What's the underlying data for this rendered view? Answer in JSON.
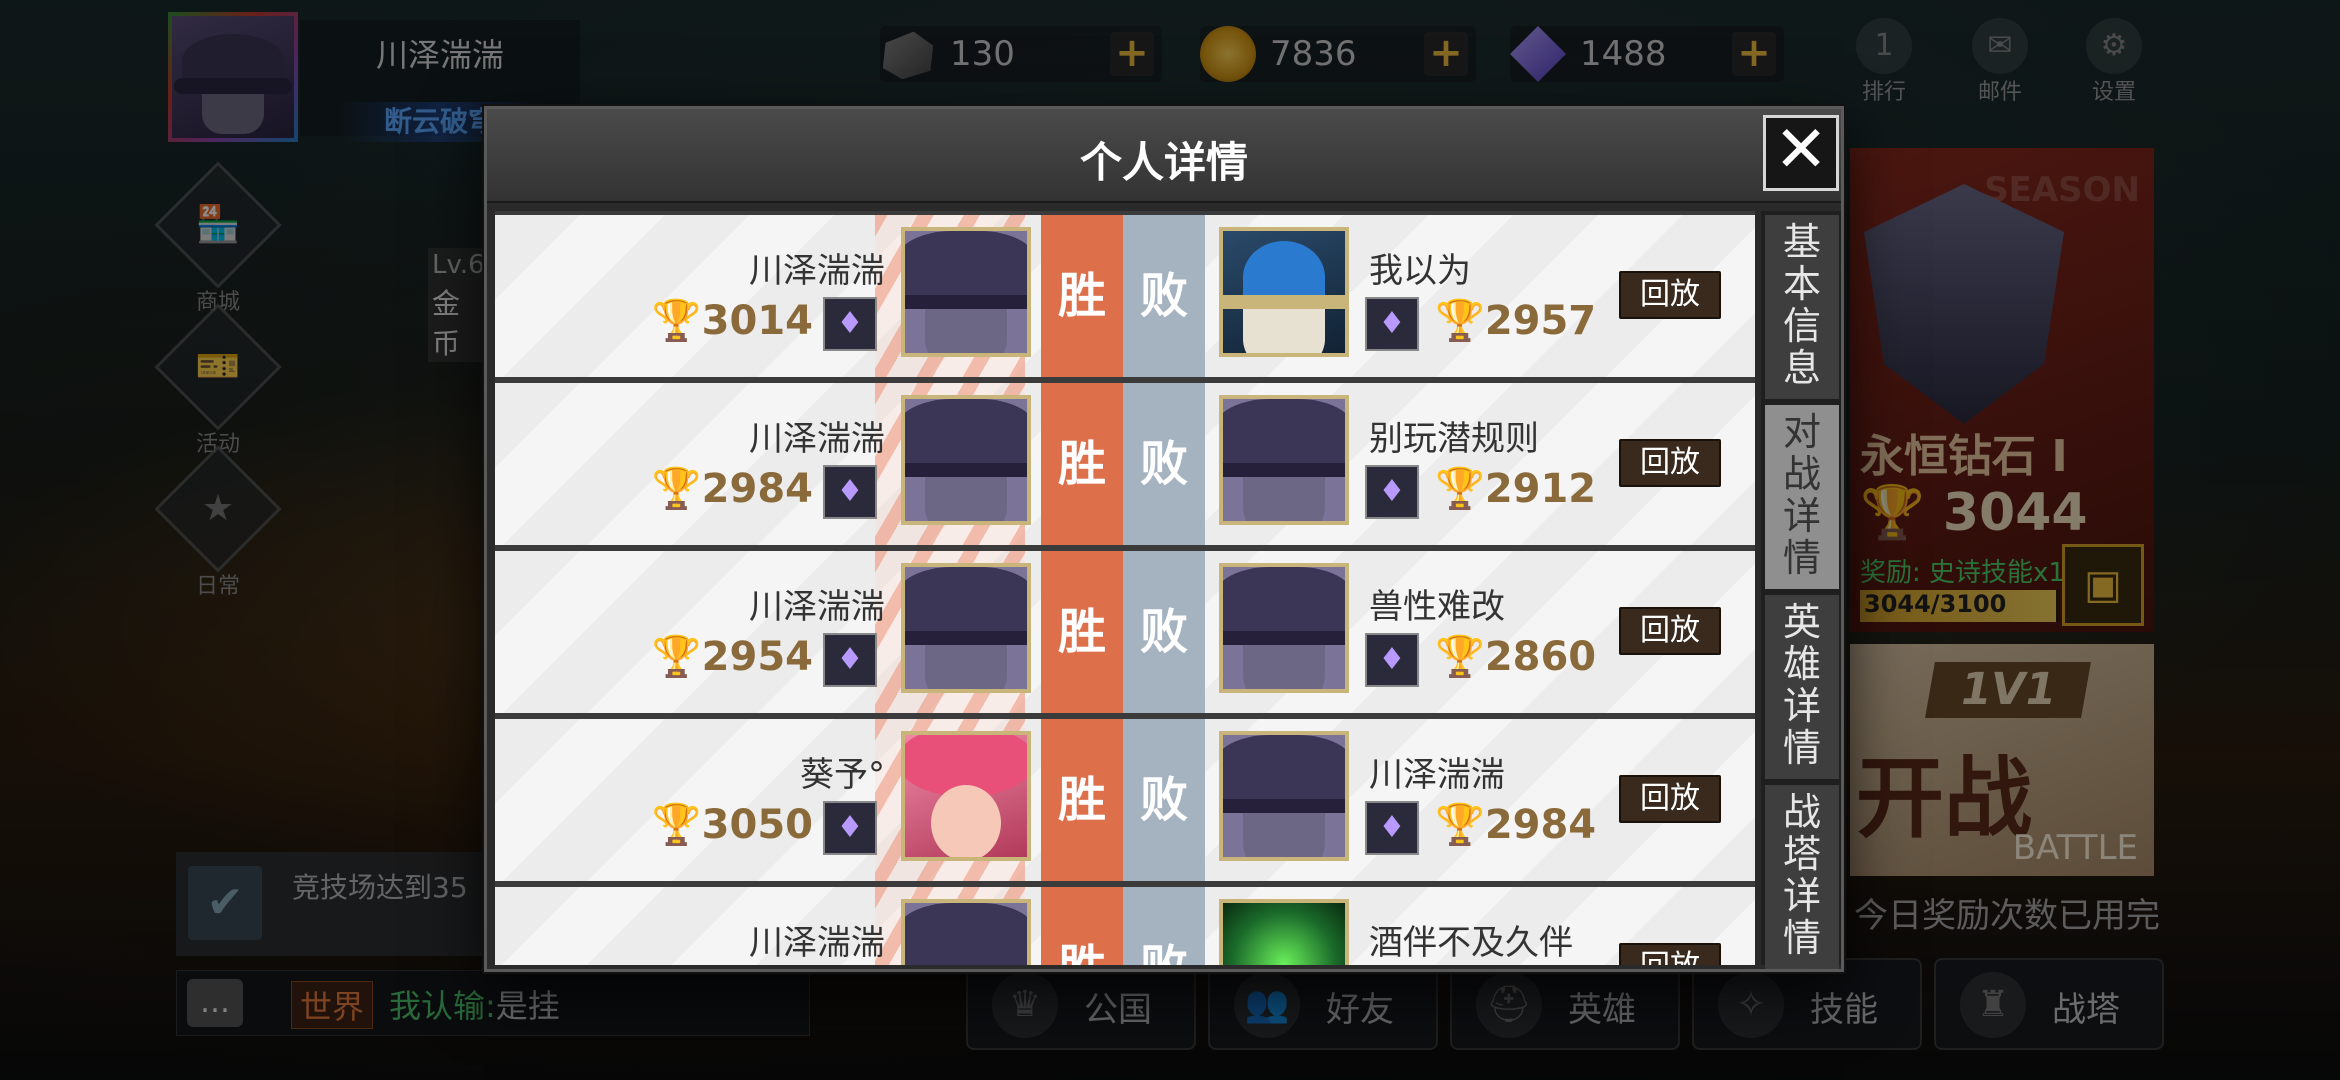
{
  "player": {
    "name": "川泽湍湍",
    "title": "断云破穹",
    "level": "Lv.6",
    "gold_label": "金币"
  },
  "currencies": [
    {
      "icon": "stone-icon",
      "value": "130"
    },
    {
      "icon": "gold-coin-icon",
      "value": "7836"
    },
    {
      "icon": "diamond-icon",
      "value": "1488"
    }
  ],
  "top_menu": {
    "rank_label": "排行",
    "rank_badge": "1",
    "mail_label": "邮件",
    "settings_label": "设置"
  },
  "side_menu": {
    "shop": "商城",
    "events": "活动",
    "daily": "日常"
  },
  "quest": {
    "text": "竞技场达到35"
  },
  "chat": {
    "channel": "世界",
    "sender": "我认输:",
    "message": "是挂"
  },
  "bottom_nav": [
    "公国",
    "好友",
    "英雄",
    "技能",
    "战塔"
  ],
  "season": {
    "label": "SEASON",
    "tier": "永恒钻石 Ⅰ",
    "points": "3044",
    "reward_prefix": "奖励:",
    "reward": "史诗技能x1",
    "progress": 0.982,
    "progress_text": "3044/3100"
  },
  "battle": {
    "mode": "1V1",
    "start": "开战",
    "sub": "BATTLE",
    "note": "今日奖励次数已用完"
  },
  "modal": {
    "title": "个人详情",
    "close": "✕",
    "win_label": "胜",
    "lose_label": "败",
    "replay_label": "回放",
    "tabs": [
      "基本信息",
      "对战详情",
      "英雄详情",
      "战塔详情"
    ],
    "active_tab": 1,
    "matches": [
      {
        "left_name": "川泽湍湍",
        "left_trophy": "3014",
        "left_hero": "theme-a",
        "right_name": "我以为",
        "right_trophy": "2957",
        "right_hero": "theme-b"
      },
      {
        "left_name": "川泽湍湍",
        "left_trophy": "2984",
        "left_hero": "theme-a",
        "right_name": "别玩潜规则",
        "right_trophy": "2912",
        "right_hero": "theme-a"
      },
      {
        "left_name": "川泽湍湍",
        "left_trophy": "2954",
        "left_hero": "theme-a",
        "right_name": "兽性难改",
        "right_trophy": "2860",
        "right_hero": "theme-a"
      },
      {
        "left_name": "葵予°",
        "left_trophy": "3050",
        "left_hero": "theme-c",
        "right_name": "川泽湍湍",
        "right_trophy": "2984",
        "right_hero": "theme-a"
      },
      {
        "left_name": "川泽湍湍",
        "left_trophy": "",
        "left_hero": "theme-a",
        "right_name": "酒伴不及久伴",
        "right_trophy": "",
        "right_hero": "theme-d"
      }
    ]
  }
}
